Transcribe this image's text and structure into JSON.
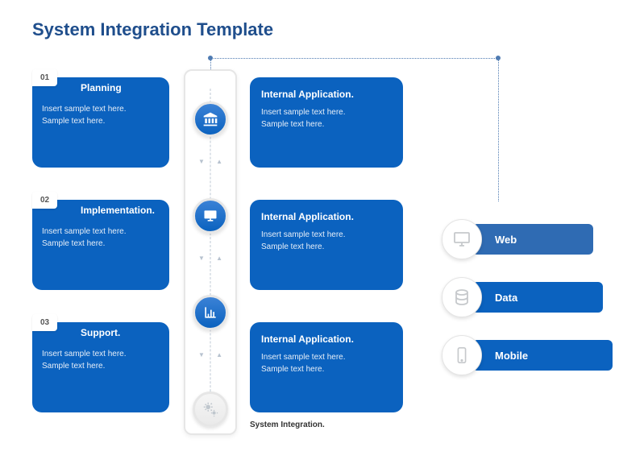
{
  "title": "System Integration Template",
  "caption": "System Integration.",
  "colors": {
    "brand": "#0b62bf",
    "titleText": "#1f4e8c",
    "web": "#2f6bb3"
  },
  "steps": [
    {
      "num": "01",
      "title": "Planning",
      "body1": "Insert sample text here.",
      "body2": "Sample text here."
    },
    {
      "num": "02",
      "title": "Implementation.",
      "body1": "Insert sample text here.",
      "body2": "Sample text here."
    },
    {
      "num": "03",
      "title": "Support.",
      "body1": "Insert sample text here.",
      "body2": "Sample text here."
    }
  ],
  "timeline": {
    "nodes": [
      {
        "icon": "bank-icon"
      },
      {
        "icon": "board-icon"
      },
      {
        "icon": "chart-icon"
      },
      {
        "icon": "gears-icon"
      }
    ]
  },
  "apps": [
    {
      "title": "Internal Application.",
      "body1": "Insert sample text here.",
      "body2": "Sample text here."
    },
    {
      "title": "Internal Application.",
      "body1": "Insert sample text here.",
      "body2": "Sample text here."
    },
    {
      "title": "Internal Application.",
      "body1": "Insert sample text here.",
      "body2": "Sample text here."
    }
  ],
  "channels": [
    {
      "label": "Web",
      "icon": "monitor-icon"
    },
    {
      "label": "Data",
      "icon": "database-icon"
    },
    {
      "label": "Mobile",
      "icon": "mobile-icon"
    }
  ]
}
